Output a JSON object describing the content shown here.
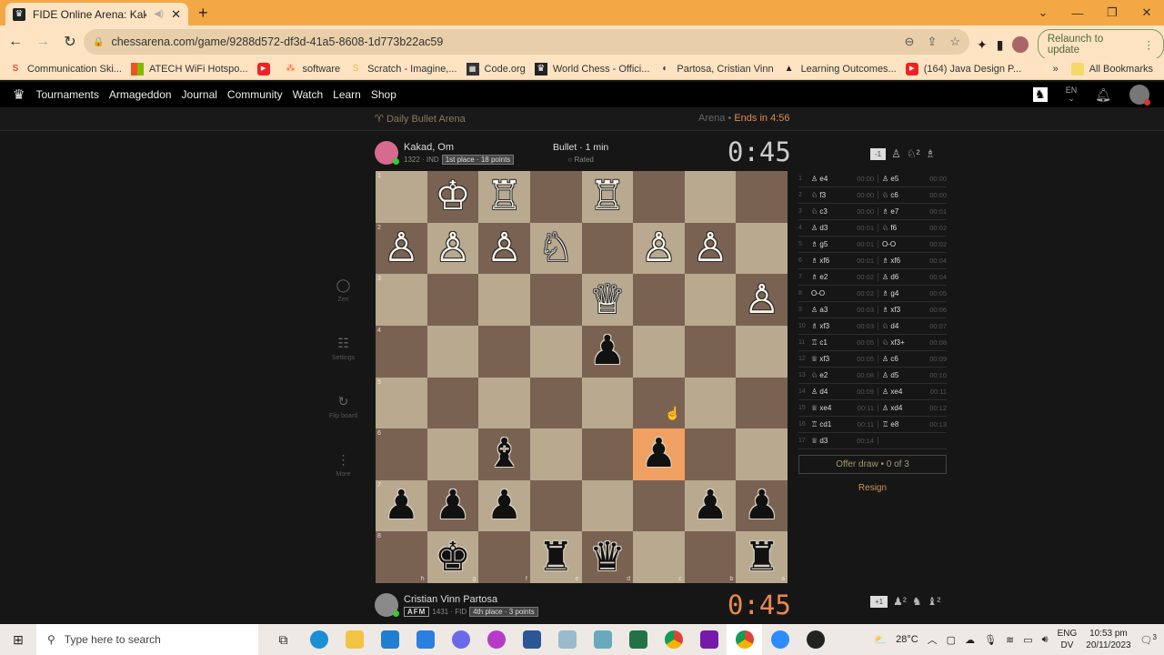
{
  "browser": {
    "tab_title": "FIDE Online Arena: Kakad, O",
    "new_tab": "+",
    "url": "chessarena.com/game/9288d572-df3d-41a5-8608-1d773b22ac59",
    "relaunch_label": "Relaunch to update",
    "bookmarks": [
      {
        "label": "Communication Ski...",
        "icon": "S",
        "color": "#e0542c"
      },
      {
        "label": "ATECH WiFi Hotspo...",
        "icon": "▦",
        "color": "#2a8"
      },
      {
        "label": "",
        "icon": "▶",
        "color": "#e22"
      },
      {
        "label": "software",
        "icon": "⁂",
        "color": "#e66a2c"
      },
      {
        "label": "Scratch - Imagine,...",
        "icon": "S",
        "color": "#e8b83a"
      },
      {
        "label": "Code.org",
        "icon": "▦",
        "color": "#333"
      },
      {
        "label": "World Chess - Offici...",
        "icon": "♛",
        "color": "#222"
      },
      {
        "label": "Partosa, Cristian Vinn",
        "icon": "◐",
        "color": "#335"
      },
      {
        "label": "Learning Outcomes...",
        "icon": "▲",
        "color": "#222"
      },
      {
        "label": "(164) Java Design P...",
        "icon": "▶",
        "color": "#e22"
      }
    ],
    "more_bookmarks": "»",
    "all_bookmarks": "All Bookmarks"
  },
  "site_nav": {
    "items": [
      "Tournaments",
      "Armageddon",
      "Journal",
      "Community",
      "Watch",
      "Learn",
      "Shop"
    ],
    "lang": "EN"
  },
  "arena": {
    "name": "Daily Bullet Arena",
    "type": "Arena",
    "ends_label": "Ends in 4:56"
  },
  "game": {
    "type": "Bullet · 1 min",
    "rated": "Rated"
  },
  "top_player": {
    "name": "Kakad, Om",
    "rating": "1322 · IND",
    "standing": "1st place · 18 points",
    "clock": "0:45",
    "material_diff": "-1",
    "captured": [
      "♙",
      "♘²",
      "♗"
    ]
  },
  "bottom_player": {
    "name": "Cristian Vinn Partosa",
    "title": "AFM",
    "rating": "1431 · FID",
    "standing": "4th place · 3 points",
    "clock": "0:45",
    "material_diff": "+1",
    "captured": [
      "♟²",
      "♞",
      "♝²"
    ]
  },
  "board": {
    "orientation": "black",
    "ranks_top_to_bottom": [
      "1",
      "2",
      "3",
      "4",
      "5",
      "6",
      "7",
      "8"
    ],
    "files_left_to_right": [
      "h",
      "g",
      "f",
      "e",
      "d",
      "c",
      "b",
      "a"
    ],
    "highlight": [
      "c6"
    ],
    "pieces": [
      [
        "",
        "♔w",
        "♖w",
        "",
        "♖w",
        "",
        "",
        ""
      ],
      [
        "♙w",
        "♙w",
        "♙w",
        "♘w",
        "",
        "♙w",
        "♙w",
        ""
      ],
      [
        "",
        "",
        "",
        "",
        "♕w",
        "",
        "",
        "♙w"
      ],
      [
        "",
        "",
        "",
        "",
        "♟b",
        "",
        "",
        ""
      ],
      [
        "",
        "",
        "",
        "",
        "",
        "",
        "",
        ""
      ],
      [
        "",
        "",
        "♝b",
        "",
        "",
        "♟b",
        "",
        ""
      ],
      [
        "♟b",
        "♟b",
        "♟b",
        "",
        "",
        "",
        "♟b",
        "♟b"
      ],
      [
        "",
        "♚b",
        "",
        "♜b",
        "♛b",
        "",
        "",
        "♜b"
      ]
    ]
  },
  "tools": [
    {
      "label": "Zen",
      "icon": "◯"
    },
    {
      "label": "Settings",
      "icon": "☷"
    },
    {
      "label": "Flip board",
      "icon": "↻"
    },
    {
      "label": "More",
      "icon": "⋮"
    }
  ],
  "moves": [
    {
      "n": "1",
      "w": "♙ e4",
      "wt": "00:00",
      "b": "♙ e5",
      "bt": "00:00"
    },
    {
      "n": "2",
      "w": "♘ f3",
      "wt": "00:00",
      "b": "♘ c6",
      "bt": "00:00"
    },
    {
      "n": "3",
      "w": "♘ c3",
      "wt": "00:00",
      "b": "♗ e7",
      "bt": "00:01"
    },
    {
      "n": "4",
      "w": "♙ d3",
      "wt": "00:01",
      "b": "♘ f6",
      "bt": "00:02"
    },
    {
      "n": "5",
      "w": "♗ g5",
      "wt": "00:01",
      "b": "O-O",
      "bt": "00:02"
    },
    {
      "n": "6",
      "w": "♗ xf6",
      "wt": "00:01",
      "b": "♗ xf6",
      "bt": "00:04"
    },
    {
      "n": "7",
      "w": "♗ e2",
      "wt": "00:02",
      "b": "♙ d6",
      "bt": "00:04"
    },
    {
      "n": "8",
      "w": "O-O",
      "wt": "00:02",
      "b": "♗ g4",
      "bt": "00:05"
    },
    {
      "n": "9",
      "w": "♙ a3",
      "wt": "00:03",
      "b": "♗ xf3",
      "bt": "00:06"
    },
    {
      "n": "10",
      "w": "♗ xf3",
      "wt": "00:03",
      "b": "♘ d4",
      "bt": "00:07"
    },
    {
      "n": "11",
      "w": "♖ c1",
      "wt": "00:05",
      "b": "♘ xf3+",
      "bt": "00:08"
    },
    {
      "n": "12",
      "w": "♕ xf3",
      "wt": "00:05",
      "b": "♙ c6",
      "bt": "00:09"
    },
    {
      "n": "13",
      "w": "♘ e2",
      "wt": "00:08",
      "b": "♙ d5",
      "bt": "00:10"
    },
    {
      "n": "14",
      "w": "♙ d4",
      "wt": "00:09",
      "b": "♙ xe4",
      "bt": "00:11"
    },
    {
      "n": "15",
      "w": "♕ xe4",
      "wt": "00:11",
      "b": "♙ xd4",
      "bt": "00:12"
    },
    {
      "n": "16",
      "w": "♖ cd1",
      "wt": "00:11",
      "b": "♖ e8",
      "bt": "00:13"
    },
    {
      "n": "17",
      "w": "♕ d3",
      "wt": "00:14",
      "b": "",
      "bt": ""
    }
  ],
  "actions": {
    "offer_draw": "Offer draw • 0 of 3",
    "resign": "Resign"
  },
  "taskbar": {
    "search_placeholder": "Type here to search",
    "weather": "28°C",
    "lang_top": "ENG",
    "lang_bottom": "DV",
    "time": "10:53 pm",
    "date": "20/11/2023",
    "notifications": "3"
  }
}
